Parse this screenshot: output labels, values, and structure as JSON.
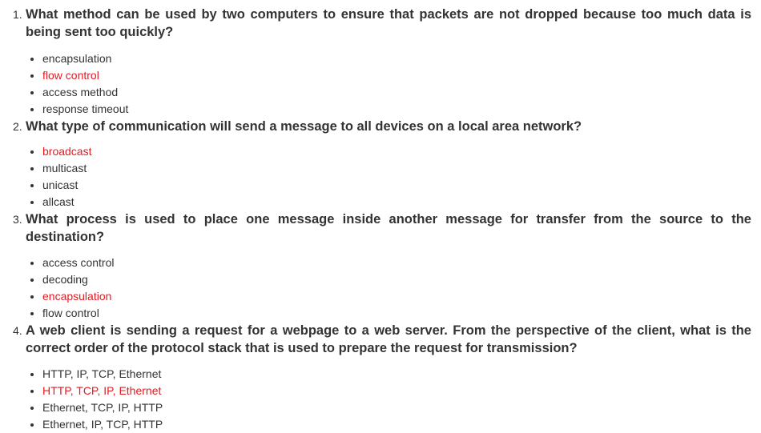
{
  "questions": [
    {
      "number": "1.",
      "text": "What method can be used by two computers to ensure that packets are not dropped because too much data is being sent too quickly?",
      "answers": [
        {
          "text": "encapsulation",
          "correct": false
        },
        {
          "text": "flow control",
          "correct": true
        },
        {
          "text": "access method",
          "correct": false
        },
        {
          "text": "response timeout",
          "correct": false
        }
      ]
    },
    {
      "number": "2.",
      "text": "What type of communication will send a message to all devices on a local area network?",
      "answers": [
        {
          "text": "broadcast",
          "correct": true
        },
        {
          "text": "multicast",
          "correct": false
        },
        {
          "text": "unicast",
          "correct": false
        },
        {
          "text": "allcast",
          "correct": false
        }
      ]
    },
    {
      "number": "3.",
      "text": "What process is used to place one message inside another message for transfer from the source to the destination?",
      "answers": [
        {
          "text": "access control",
          "correct": false
        },
        {
          "text": "decoding",
          "correct": false
        },
        {
          "text": "encapsulation",
          "correct": true
        },
        {
          "text": "flow control",
          "correct": false
        }
      ]
    },
    {
      "number": "4.",
      "text": "A web client is sending a request for a webpage to a web server. From the perspective of the client, what is the correct order of the protocol stack that is used to prepare the request for transmission?",
      "answers": [
        {
          "text": "HTTP, IP, TCP, Ethernet",
          "correct": false
        },
        {
          "text": "HTTP, TCP, IP, Ethernet",
          "correct": true
        },
        {
          "text": "Ethernet, TCP, IP, HTTP",
          "correct": false
        },
        {
          "text": "Ethernet, IP, TCP, HTTP",
          "correct": false
        }
      ]
    }
  ],
  "colors": {
    "text": "#333333",
    "correct_answer": "#e31b23",
    "background": "#ffffff"
  }
}
